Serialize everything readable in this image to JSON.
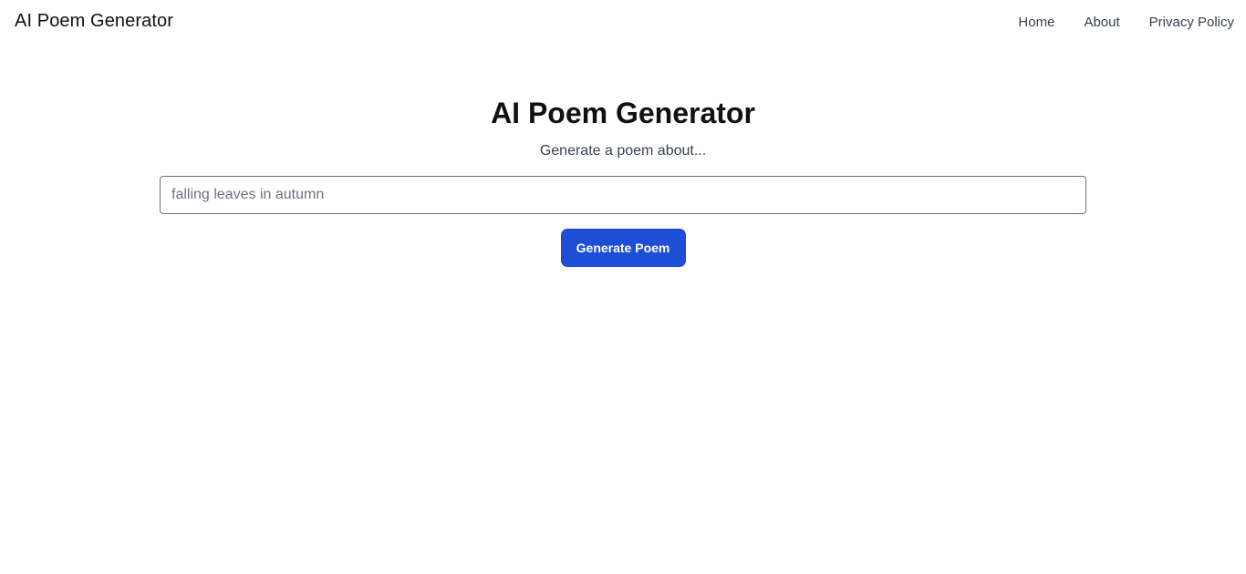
{
  "header": {
    "brand": "AI Poem Generator",
    "nav": [
      {
        "label": "Home"
      },
      {
        "label": "About"
      },
      {
        "label": "Privacy Policy"
      }
    ]
  },
  "main": {
    "title": "AI Poem Generator",
    "subtitle": "Generate a poem about...",
    "topic_input": {
      "value": "",
      "placeholder": "falling leaves in autumn"
    },
    "generate_label": "Generate Poem"
  },
  "colors": {
    "accent": "#1d4ed8",
    "nav_text": "#374151",
    "input_border": "#6b7280"
  }
}
